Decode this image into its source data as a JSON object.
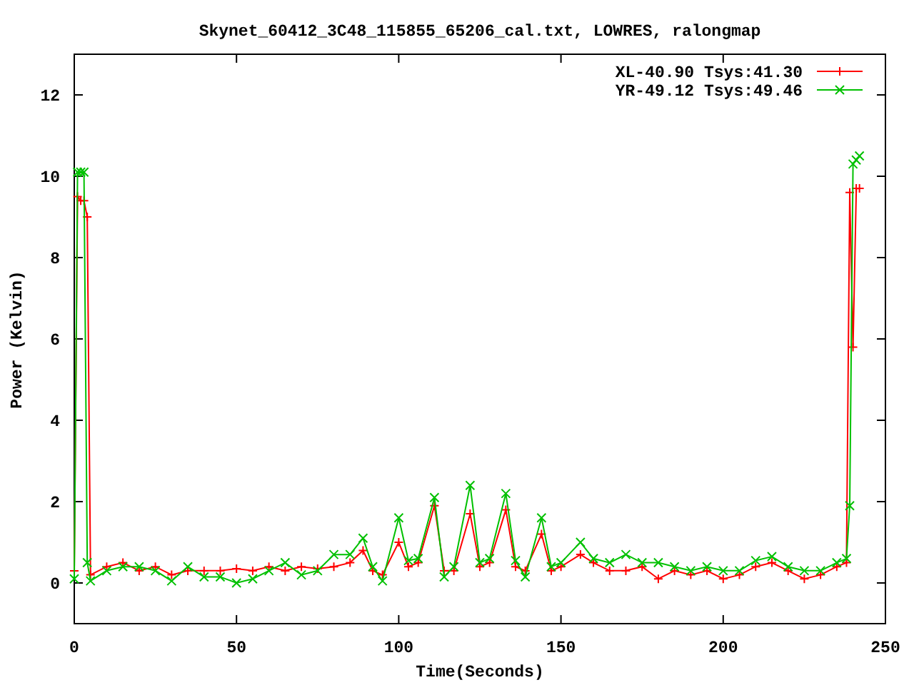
{
  "chart_data": {
    "type": "line",
    "title": "Skynet_60412_3C48_115855_65206_cal.txt, LOWRES, ralongmap",
    "xlabel": "Time(Seconds)",
    "ylabel": "Power (Kelvin)",
    "x": [
      0,
      1,
      2,
      3,
      4,
      5,
      10,
      15,
      20,
      25,
      30,
      35,
      40,
      45,
      50,
      55,
      60,
      65,
      70,
      75,
      80,
      85,
      89,
      92,
      95,
      100,
      103,
      106,
      111,
      114,
      117,
      122,
      125,
      128,
      133,
      136,
      139,
      144,
      147,
      150,
      156,
      160,
      165,
      170,
      175,
      180,
      185,
      190,
      195,
      200,
      205,
      210,
      215,
      220,
      225,
      230,
      235,
      238,
      239,
      240,
      241,
      242
    ],
    "series": [
      {
        "name": "XL-40.90 Tsys:41.30",
        "color": "#ff0000",
        "marker": "plus",
        "values": [
          0.3,
          9.5,
          9.4,
          9.4,
          9.0,
          0.2,
          0.4,
          0.5,
          0.3,
          0.4,
          0.2,
          0.3,
          0.3,
          0.3,
          0.35,
          0.3,
          0.4,
          0.3,
          0.4,
          0.35,
          0.4,
          0.5,
          0.8,
          0.3,
          0.2,
          1.0,
          0.4,
          0.5,
          1.9,
          0.3,
          0.3,
          1.7,
          0.4,
          0.5,
          1.8,
          0.4,
          0.3,
          1.2,
          0.3,
          0.4,
          0.7,
          0.5,
          0.3,
          0.3,
          0.4,
          0.1,
          0.3,
          0.2,
          0.3,
          0.1,
          0.2,
          0.4,
          0.5,
          0.3,
          0.1,
          0.2,
          0.4,
          0.5,
          9.6,
          5.8,
          9.7,
          9.7
        ]
      },
      {
        "name": "YR-49.12 Tsys:49.46",
        "color": "#00c000",
        "marker": "cross",
        "values": [
          0.1,
          10.1,
          10.1,
          10.1,
          0.5,
          0.05,
          0.3,
          0.4,
          0.4,
          0.3,
          0.05,
          0.4,
          0.15,
          0.15,
          0.0,
          0.1,
          0.3,
          0.5,
          0.2,
          0.3,
          0.7,
          0.7,
          1.1,
          0.4,
          0.05,
          1.6,
          0.55,
          0.6,
          2.1,
          0.15,
          0.4,
          2.4,
          0.5,
          0.6,
          2.2,
          0.55,
          0.15,
          1.6,
          0.4,
          0.5,
          1.0,
          0.6,
          0.5,
          0.7,
          0.5,
          0.5,
          0.4,
          0.3,
          0.4,
          0.3,
          0.3,
          0.55,
          0.65,
          0.4,
          0.3,
          0.3,
          0.5,
          0.6,
          1.9,
          10.3,
          10.4,
          10.5
        ]
      }
    ],
    "legend": true,
    "xlim": [
      0,
      250
    ],
    "ylim": [
      -1,
      13
    ],
    "xticks": [
      0,
      50,
      100,
      150,
      200,
      250
    ],
    "yticks": [
      0,
      2,
      4,
      6,
      8,
      10,
      12
    ]
  }
}
